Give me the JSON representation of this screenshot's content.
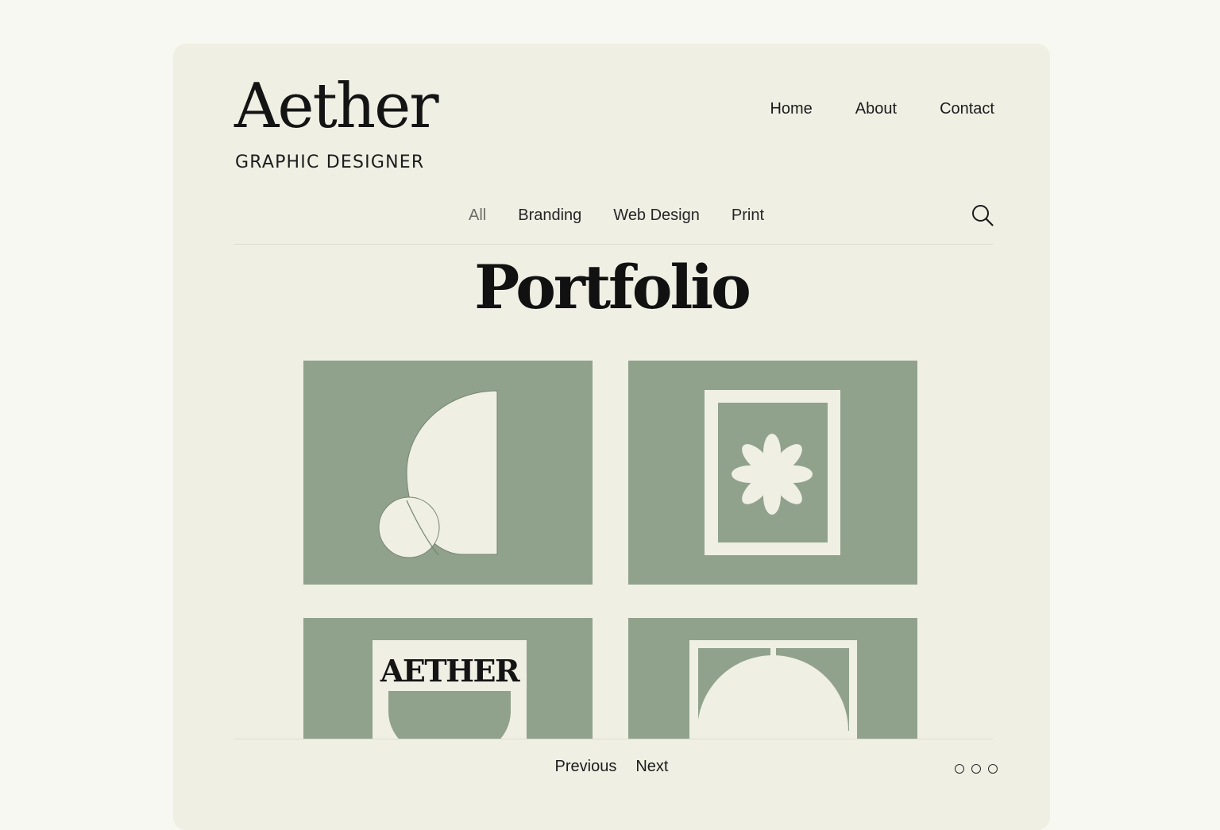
{
  "brand": {
    "name": "Aether",
    "tagline": "GRAPHIC DESIGNER"
  },
  "nav": {
    "items": [
      {
        "label": "Home"
      },
      {
        "label": "About"
      },
      {
        "label": "Contact"
      }
    ]
  },
  "filters": {
    "items": [
      {
        "label": "All",
        "active": true
      },
      {
        "label": "Branding"
      },
      {
        "label": "Web Design"
      },
      {
        "label": "Print"
      }
    ],
    "search_icon": "search-icon"
  },
  "page": {
    "title": "Portfolio"
  },
  "portfolio": {
    "items": [
      {
        "name": "geometric-arch-circle",
        "motif": "half-arch-and-circle"
      },
      {
        "name": "framed-flower",
        "motif": "flower-in-frame"
      },
      {
        "name": "aether-cup-print",
        "motif": "wordmark-and-cup",
        "text": "AETHER"
      },
      {
        "name": "framed-arch",
        "motif": "circle-in-frame"
      }
    ]
  },
  "pagination": {
    "previous_label": "Previous",
    "next_label": "Next",
    "dot_count": 3
  },
  "colors": {
    "background": "#f8f8f2",
    "panel": "#efefe4",
    "sage": "#91a28c",
    "ink": "#141414"
  }
}
